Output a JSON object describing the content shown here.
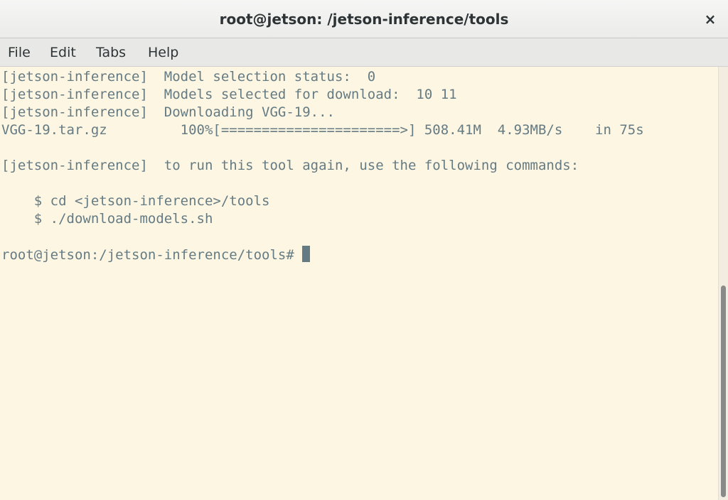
{
  "window": {
    "title": "root@jetson: /jetson-inference/tools",
    "close_glyph": "×"
  },
  "menu": {
    "items": [
      "File",
      "Edit",
      "Tabs",
      "Help"
    ]
  },
  "terminal": {
    "lines": [
      "[jetson-inference]  Model selection status:  0",
      "[jetson-inference]  Models selected for download:  10 11",
      "[jetson-inference]  Downloading VGG-19...",
      "VGG-19.tar.gz         100%[======================>] 508.41M  4.93MB/s    in 75s",
      "",
      "[jetson-inference]  to run this tool again, use the following commands:",
      "",
      "    $ cd <jetson-inference>/tools",
      "    $ ./download-models.sh",
      "",
      "root@jetson:/jetson-inference/tools# "
    ],
    "colors": {
      "background": "#fdf6e3",
      "foreground": "#657b83"
    }
  }
}
